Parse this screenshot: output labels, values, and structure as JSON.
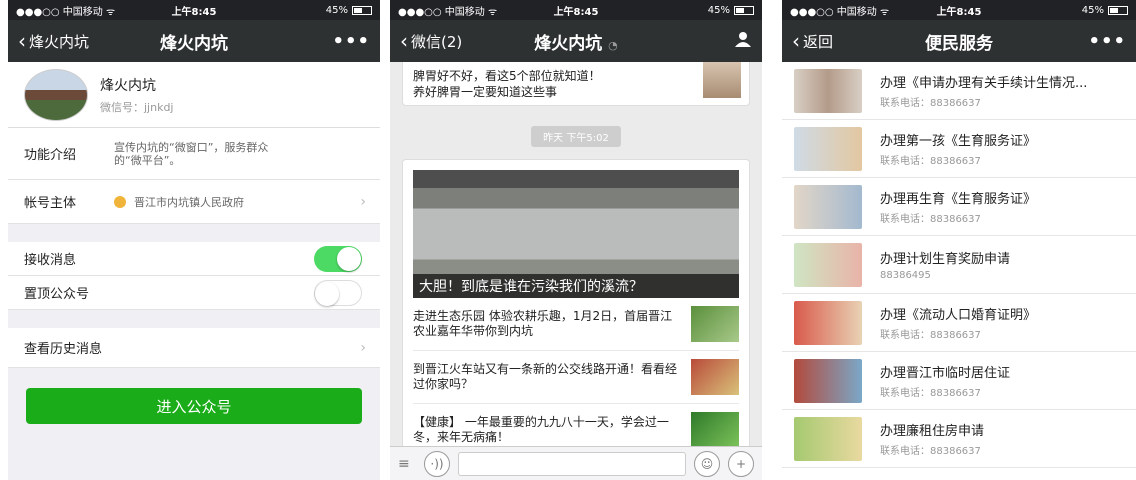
{
  "status": {
    "carrier": "●●●○○ 中国移动 ᯤ",
    "time": "上午8:45",
    "battery": "45%",
    "battery_level": 0.45
  },
  "phone1": {
    "nav": {
      "back": "烽火内坑",
      "title": "烽火内坑",
      "more": "•••"
    },
    "profile": {
      "name": "烽火内坑",
      "wechat_id": "微信号：jjnkdj"
    },
    "intro": {
      "label": "功能介绍",
      "value": "宣传内坑的“微窗口”，服务群众的“微平台”。"
    },
    "owner": {
      "label": "帐号主体",
      "value": "晋江市内坑镇人民政府"
    },
    "receive": {
      "label": "接收消息",
      "on": true
    },
    "pin": {
      "label": "置顶公众号",
      "on": false
    },
    "history": {
      "label": "查看历史消息"
    },
    "enter_button": "进入公众号"
  },
  "phone2": {
    "nav": {
      "back": "微信(2)",
      "title": "烽火内坑",
      "title_icon": "ear-icon",
      "right_icon": "person-icon"
    },
    "top_card": {
      "line1": "脾胃好不好，看这5个部位就知道！",
      "line2": "养好脾胃一定要知道这些事"
    },
    "time_label": "昨天 下午5:02",
    "hero_caption": "大胆！到底是谁在污染我们的溪流？",
    "articles": [
      {
        "title": "走进生态乐园 体验农耕乐趣，1月2日，首届晋江农业嘉年华带你到内坑"
      },
      {
        "title": "到晋江火车站又有一条新的公交线路开通！看看经过你家吗？"
      },
      {
        "title": "【健康】 一年最重要的九九八十一天，学会过一冬，来年无病痛！"
      }
    ],
    "inputbar": {
      "menu_icon": "≡",
      "voice_icon": "·))",
      "emoji_icon": "☺",
      "plus_icon": "+"
    }
  },
  "phone3": {
    "nav": {
      "back": "返回",
      "title": "便民服务",
      "more": "•••"
    },
    "services": [
      {
        "title": "办理《申请办理有关手续计生情况...",
        "sub": "联系电话：88386637"
      },
      {
        "title": "办理第一孩《生育服务证》",
        "sub": "联系电话：88386637"
      },
      {
        "title": "办理再生育《生育服务证》",
        "sub": "联系电话：88386637"
      },
      {
        "title": "办理计划生育奖励申请",
        "sub": "88386495"
      },
      {
        "title": "办理《流动人口婚育证明》",
        "sub": "联系电话：88386637"
      },
      {
        "title": "办理晋江市临时居住证",
        "sub": "联系电话：88386637"
      },
      {
        "title": "办理廉租住房申请",
        "sub": "联系电话：88386637"
      }
    ]
  }
}
